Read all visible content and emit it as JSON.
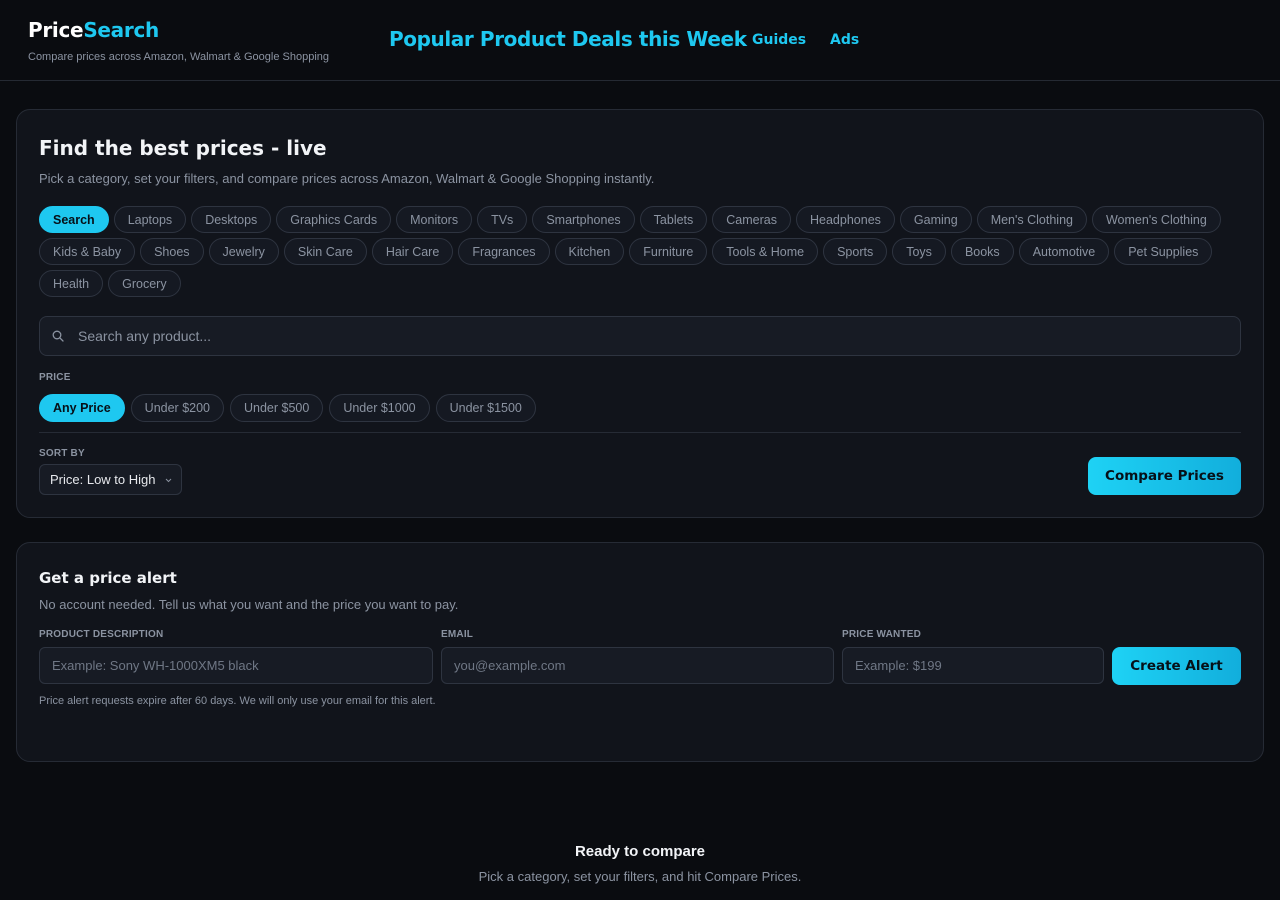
{
  "brand": {
    "part1": "Price",
    "part2": "Search",
    "tagline": "Compare prices across Amazon, Walmart & Google Shopping"
  },
  "nav": {
    "headline": "Popular Product Deals this Week",
    "guides": "Guides",
    "ads": "Ads"
  },
  "search_card": {
    "title": "Find the best prices - live",
    "subtitle": "Pick a category, set your filters, and compare prices across Amazon, Walmart & Google Shopping instantly.",
    "categories": [
      "Search",
      "Laptops",
      "Desktops",
      "Graphics Cards",
      "Monitors",
      "TVs",
      "Smartphones",
      "Tablets",
      "Cameras",
      "Headphones",
      "Gaming",
      "Men's Clothing",
      "Women's Clothing",
      "Kids & Baby",
      "Shoes",
      "Jewelry",
      "Skin Care",
      "Hair Care",
      "Fragrances",
      "Kitchen",
      "Furniture",
      "Tools & Home",
      "Sports",
      "Toys",
      "Books",
      "Automotive",
      "Pet Supplies",
      "Health",
      "Grocery"
    ],
    "active_category": "Search",
    "search_placeholder": "Search any product...",
    "price_label": "PRICE",
    "price_options": [
      "Any Price",
      "Under $200",
      "Under $500",
      "Under $1000",
      "Under $1500"
    ],
    "active_price": "Any Price",
    "sort_label": "SORT BY",
    "sort_value": "Price: Low to High",
    "compare_button": "Compare Prices"
  },
  "alert_card": {
    "title": "Get a price alert",
    "subtitle": "No account needed. Tell us what you want and the price you want to pay.",
    "product_label": "PRODUCT DESCRIPTION",
    "product_placeholder": "Example: Sony WH-1000XM5 black",
    "email_label": "EMAIL",
    "email_placeholder": "you@example.com",
    "price_label": "PRICE WANTED",
    "price_placeholder": "Example: $199",
    "create_button": "Create Alert",
    "note": "Price alert requests expire after 60 days. We will only use your email for this alert."
  },
  "empty_state": {
    "title": "Ready to compare",
    "subtitle": "Pick a category, set your filters, and hit Compare Prices."
  },
  "colors": {
    "accent": "#1ec8f0",
    "background": "#0a0c10",
    "card": "#11141b"
  }
}
